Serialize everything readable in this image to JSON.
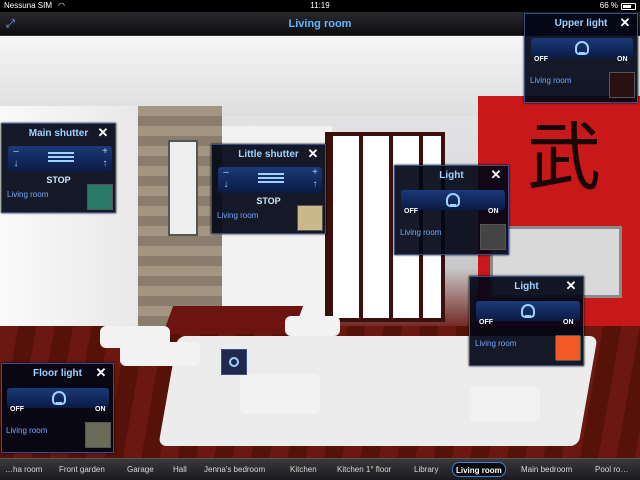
{
  "status_bar": {
    "carrier": "Nessuna SIM",
    "time": "11:19",
    "battery": "66 %"
  },
  "nav": {
    "title": "Living room"
  },
  "panels": {
    "main_shutter": {
      "title": "Main shutter",
      "stop": "STOP",
      "room": "Living room"
    },
    "little_shutter": {
      "title": "Little shutter",
      "stop": "STOP",
      "room": "Living room"
    },
    "light_center": {
      "title": "Light",
      "off": "OFF",
      "on": "ON",
      "room": "Living room"
    },
    "light_right": {
      "title": "Light",
      "off": "OFF",
      "on": "ON",
      "room": "Living room"
    },
    "upper_light": {
      "title": "Upper light",
      "off": "OFF",
      "on": "ON",
      "room": "Living room"
    },
    "floor_light": {
      "title": "Floor light",
      "off": "OFF",
      "on": "ON",
      "room": "Living room"
    }
  },
  "tabs": [
    "…ha room",
    "Front garden",
    "Garage",
    "Hall",
    "Jenna's bedroom",
    "Kitchen",
    "Kitchen 1° floor",
    "Library",
    "Living room",
    "Main bedroom",
    "Pool ro…"
  ],
  "active_tab": "Living room",
  "accent_color": "#3c7fe0"
}
